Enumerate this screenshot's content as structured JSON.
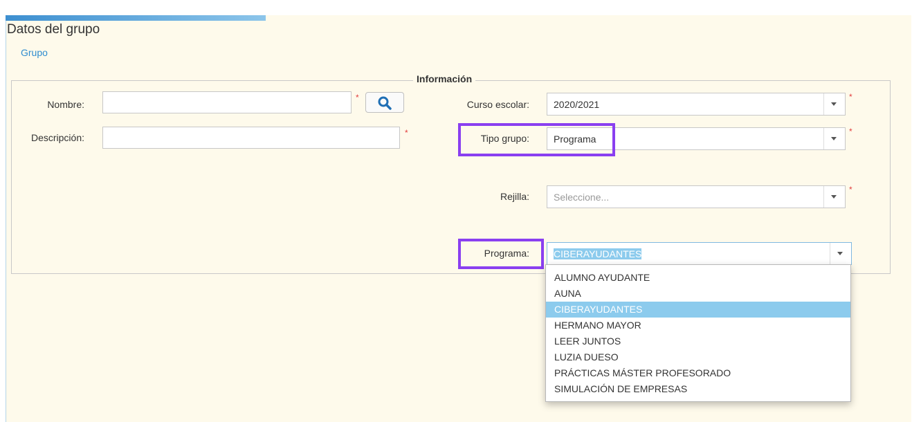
{
  "page": {
    "title": "Datos del grupo",
    "tab": "Grupo"
  },
  "form": {
    "legend": "Información",
    "nombre": {
      "label": "Nombre:",
      "value": ""
    },
    "descripcion": {
      "label": "Descripción:",
      "value": ""
    },
    "curso": {
      "label": "Curso escolar:",
      "value": "2020/2021"
    },
    "tipo": {
      "label": "Tipo grupo:",
      "value": "Programa"
    },
    "rejilla": {
      "label": "Rejilla:",
      "placeholder": "Seleccione..."
    },
    "programa": {
      "label": "Programa:",
      "value": "CIBERAYUDANTES"
    },
    "required_mark": "*"
  },
  "dropdown": {
    "options": [
      "ALUMNO AYUDANTE",
      "AUNA",
      "CIBERAYUDANTES",
      "HERMANO MAYOR",
      "LEER JUNTOS",
      "LUZIA DUESO",
      "PRÁCTICAS MÁSTER PROFESORADO",
      "SIMULACIÓN DE EMPRESAS"
    ],
    "selected_index": 2
  },
  "colors": {
    "panel_bg": "#fefaeb",
    "accent_blue": "#2f8ccf",
    "highlight_purple": "#8a3ff0",
    "selection_blue": "#8ccbed",
    "required_red": "#e23d3d"
  }
}
